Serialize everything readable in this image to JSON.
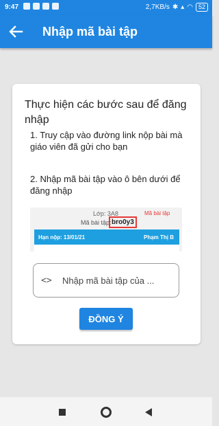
{
  "status_bar": {
    "time": "9:47",
    "network_speed": "2,7KB/s",
    "battery": "52"
  },
  "app_bar": {
    "title": "Nhập mã bài tập",
    "back_icon": "arrow-left-icon"
  },
  "card": {
    "title": "Thực hiện các bước sau để đăng nhập",
    "step1": "1. Truy cập vào đường link nộp bài mà giáo viên đã gửi cho bạn",
    "step2": "2. Nhập mã bài tập vào ô bên dưới để đăng nhập"
  },
  "illustration": {
    "lop": "Lớp: 3A8",
    "tag": "Mã bài tập",
    "ma_label": "Mã bài tập:",
    "code": "bro0y3",
    "han_nop": "Hạn nộp: 13/01/21",
    "teacher": "Phạm Thị B"
  },
  "code_input": {
    "placeholder": "Nhập mã bài tập của ...",
    "icon": "code-brackets-icon"
  },
  "confirm_button": {
    "label": "ĐỒNG Ý"
  },
  "colors": {
    "primary": "#1f85e0",
    "highlight": "#e53935"
  }
}
